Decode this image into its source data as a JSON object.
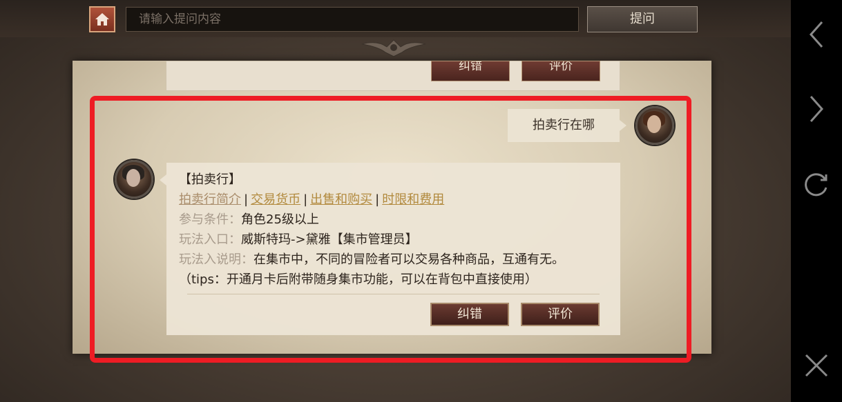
{
  "search": {
    "placeholder": "请输入提问内容"
  },
  "ask_button": "提问",
  "previous_card": {
    "correct_label": "纠错",
    "rate_label": "评价"
  },
  "question": {
    "text": "拍卖行在哪"
  },
  "answer": {
    "title": "【拍卖行】",
    "links": [
      "拍卖行简介",
      "交易货币",
      "出售和购买",
      "时限和费用"
    ],
    "separator": "|",
    "fields": [
      {
        "label": "参与条件：",
        "value": "角色25级以上"
      },
      {
        "label": "玩法入口：",
        "value": "威斯特玛->黛雅【集市管理员】"
      },
      {
        "label": "玩法入说明：",
        "value": "在集市中，不同的冒险者可以交易各种商品，互通有无。"
      }
    ],
    "tips": "（tips：开通月卡后附带随身集市功能，可以在背包中直接使用）",
    "correct_label": "纠错",
    "rate_label": "评价"
  },
  "colors": {
    "highlight": "#ee1c24",
    "link": "#b28a3e",
    "button": "#5a2c24"
  },
  "icons": {
    "home": "home-icon",
    "back": "back-icon",
    "forward": "forward-icon",
    "refresh": "refresh-icon",
    "close": "close-icon"
  }
}
